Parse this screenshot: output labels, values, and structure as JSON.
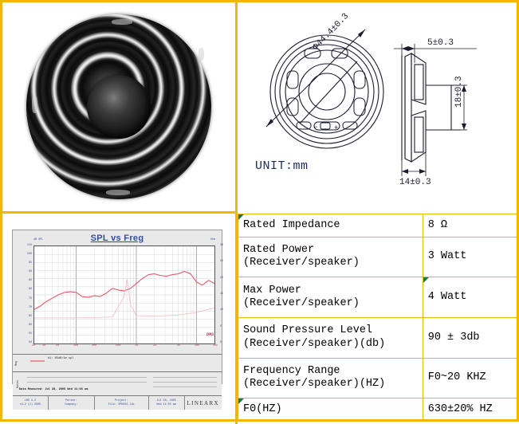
{
  "sheet": {
    "border_color": "#f5b400",
    "photo": {
      "caption": "",
      "alt_name": "speaker-front-photo"
    }
  },
  "drawing": {
    "unit_label": "UNIT:mm",
    "diameter_dim": "Φ44.4±0.3",
    "top_dim": "5±0.3",
    "height_dim": "18±0.3",
    "width_dim": "14±0.3",
    "terminal_minus": "−",
    "terminal_plus": "+"
  },
  "chart_data": {
    "type": "line",
    "title": "SPL vs Freg",
    "xlabel": "",
    "ylabel": "dB SPL",
    "y2label": "Ohm",
    "xscale": "log",
    "xlim": [
      20,
      20000
    ],
    "ylim": [
      50,
      110
    ],
    "y2lim": [
      0,
      30
    ],
    "grid": true,
    "legend_position": "below-plot",
    "xticks": [
      "20",
      "30",
      "50",
      "100",
      "200",
      "500",
      "1k",
      "2k",
      "5k",
      "10k",
      "20k"
    ],
    "yticks": [
      "110",
      "100",
      "95",
      "90",
      "85",
      "80",
      "75",
      "70",
      "65",
      "60",
      "55",
      "50"
    ],
    "y2ticks": [
      "30",
      "25",
      "20",
      "15",
      "10",
      "5",
      "0"
    ],
    "watermark": "DMS",
    "series": [
      {
        "name": "SPL",
        "color": "#e8596b",
        "x": [
          20,
          25,
          32,
          40,
          50,
          63,
          80,
          100,
          125,
          160,
          200,
          250,
          315,
          400,
          500,
          630,
          800,
          1000,
          1250,
          1600,
          2000,
          2500,
          3150,
          4000,
          5000,
          6300,
          8000,
          10000,
          12500,
          16000,
          20000
        ],
        "y": [
          71,
          73,
          76,
          78,
          80,
          81.5,
          82,
          81.5,
          79,
          78.5,
          79.5,
          79,
          81,
          84,
          83,
          82.5,
          84,
          87,
          90,
          92.5,
          93,
          92,
          91.5,
          92.5,
          93,
          94.5,
          93,
          88,
          86,
          89,
          87
        ]
      },
      {
        "name": "Impedance",
        "color": "#f3b9bf",
        "x": [
          20,
          50,
          100,
          200,
          400,
          630,
          700,
          800,
          1000,
          2000,
          5000,
          10000,
          20000
        ],
        "y": [
          7.9,
          7.9,
          7.9,
          8.0,
          8.2,
          14.5,
          20.0,
          12.0,
          8.6,
          8.4,
          8.8,
          9.6,
          11.0
        ]
      }
    ]
  },
  "chart_panel": {
    "legend_label": "#1: 85dB/1m spl",
    "note_text": "Data Measured: Jul 28, 2005 Wed 11:04 am",
    "side_tag_legend": "Mag",
    "side_tag_notes": "Notes",
    "footer": [
      {
        "line1": "LMS 4.2",
        "line2": "v4.2 (C) 2005"
      },
      {
        "line1": "Person:",
        "line2": "Company:"
      },
      {
        "line1": "Project:",
        "line2": "File: SPK003.lib"
      },
      {
        "line1": "Jul 28, 2005",
        "line2": "Wed 11:04 am"
      }
    ],
    "brand": "LINEARX"
  },
  "spec_table": {
    "rows": [
      {
        "label": "Rated  Impedance",
        "sub": "",
        "value": "8 Ω",
        "flag_label": true,
        "flag_value": false
      },
      {
        "label": "Rated  Power",
        "sub": "(Receiver/speaker)",
        "value": "3 Watt",
        "flag_label": false,
        "flag_value": false
      },
      {
        "label": "Max  Power",
        "sub": "(Receiver/speaker)",
        "value": "4 Watt",
        "flag_label": false,
        "flag_value": true
      },
      {
        "label": "Sound  Pressure  Level",
        "sub": "(Receiver/speaker)(db)",
        "value": "90 ± 3db",
        "flag_label": false,
        "flag_value": false
      },
      {
        "label": "Frequency  Range",
        "sub": "(Receiver/speaker)(HZ)",
        "value": "F0~20 KHZ",
        "flag_label": false,
        "flag_value": false
      },
      {
        "label": "F0(HZ)",
        "sub": "",
        "value": "630±20% HZ",
        "flag_label": true,
        "flag_value": false
      }
    ]
  }
}
